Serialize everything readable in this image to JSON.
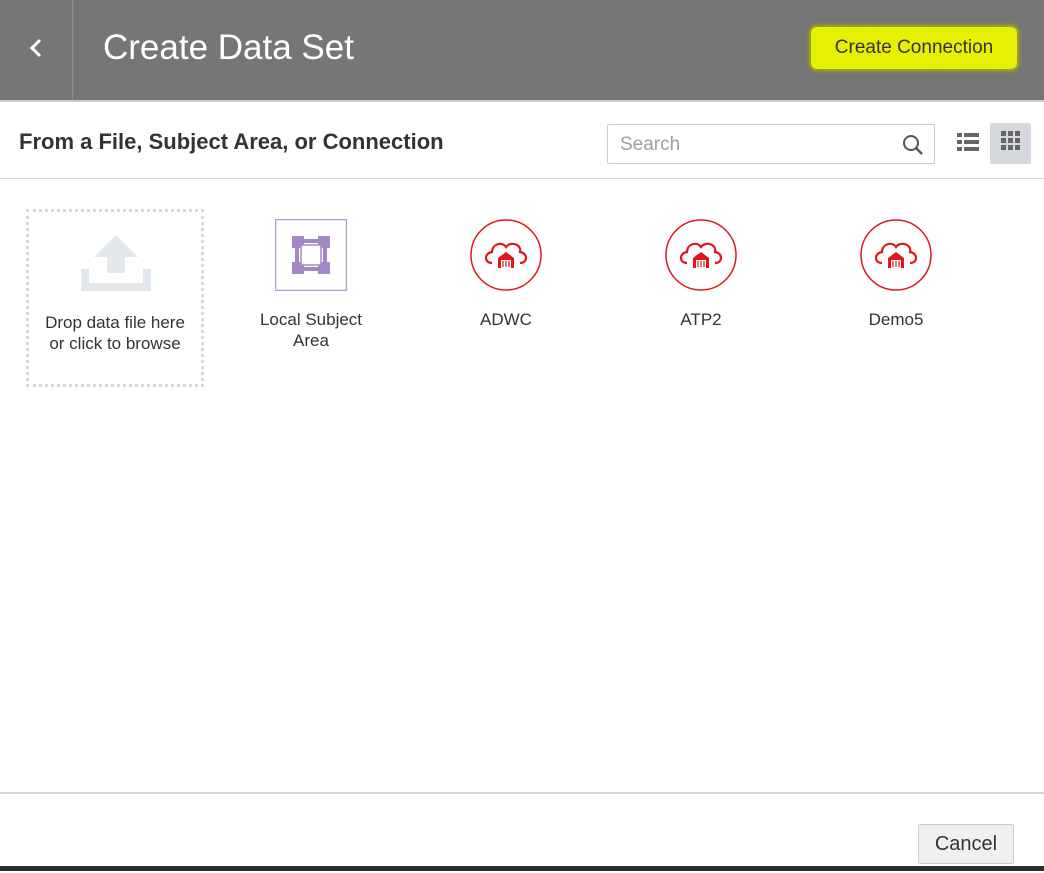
{
  "header": {
    "title": "Create Data Set",
    "create_connection_label": "Create Connection",
    "highlight_color": "#e6f000",
    "bg_color": "#767676"
  },
  "toolbar": {
    "subtitle": "From a File, Subject Area, or Connection",
    "search_placeholder": "Search",
    "search_value": "",
    "active_view": "grid"
  },
  "content": {
    "drop_zone_label": "Drop data file here\nor click to browse",
    "items": [
      {
        "label": "Local Subject\nArea",
        "icon": "subject-area-icon"
      },
      {
        "label": "ADWC",
        "icon": "cloud-database-icon"
      },
      {
        "label": "ATP2",
        "icon": "cloud-database-icon"
      },
      {
        "label": "Demo5",
        "icon": "cloud-database-icon"
      }
    ]
  },
  "footer": {
    "cancel_label": "Cancel"
  }
}
